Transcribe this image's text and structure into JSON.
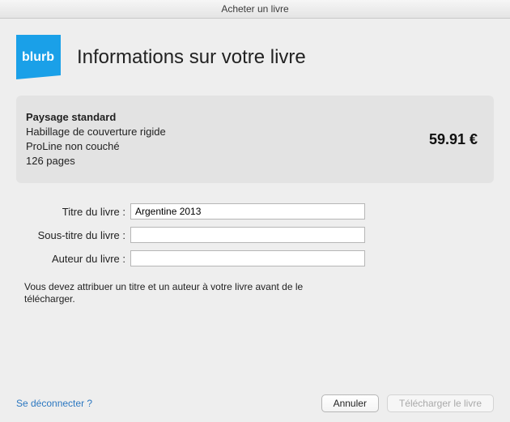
{
  "window": {
    "title": "Acheter un livre"
  },
  "brand": {
    "name": "blurb"
  },
  "page_title": "Informations sur votre livre",
  "summary": {
    "format": "Paysage standard",
    "cover": "Habillage de couverture rigide",
    "paper": "ProLine non couché",
    "pages": "126 pages",
    "price": "59.91 €"
  },
  "form": {
    "title_label": "Titre du livre :",
    "title_value": "Argentine 2013",
    "subtitle_label": "Sous-titre du livre :",
    "subtitle_value": "",
    "author_label": "Auteur du livre :",
    "author_value": ""
  },
  "hint": "Vous devez attribuer un titre et un auteur à votre livre avant de le télécharger.",
  "footer": {
    "signout": "Se déconnecter ?",
    "cancel": "Annuler",
    "upload": "Télécharger le livre"
  }
}
